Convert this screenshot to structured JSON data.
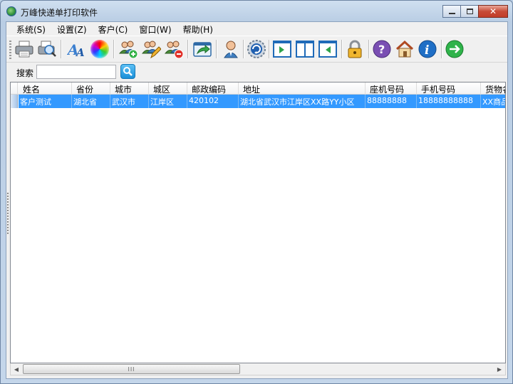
{
  "window": {
    "title": "万峰快递单打印软件"
  },
  "menu": [
    {
      "label": "系统(S)"
    },
    {
      "label": "设置(Z)"
    },
    {
      "label": "客户(C)"
    },
    {
      "label": "窗口(W)"
    },
    {
      "label": "帮助(H)"
    }
  ],
  "search": {
    "label": "搜索",
    "value": ""
  },
  "table": {
    "columns": [
      "姓名",
      "省份",
      "城市",
      "城区",
      "邮政编码",
      "地址",
      "座机号码",
      "手机号码",
      "货物名"
    ],
    "rows": [
      [
        "客户测试",
        "湖北省",
        "武汉市",
        "江岸区",
        "420102",
        "湖北省武汉市江岸区XX路YY小区",
        "88888888",
        "18888888888",
        "XX商品"
      ]
    ]
  },
  "scrollbar": {
    "thumb_grip": "III"
  },
  "colors": {
    "selection": "#3399ff",
    "close_button": "#c74b37"
  }
}
